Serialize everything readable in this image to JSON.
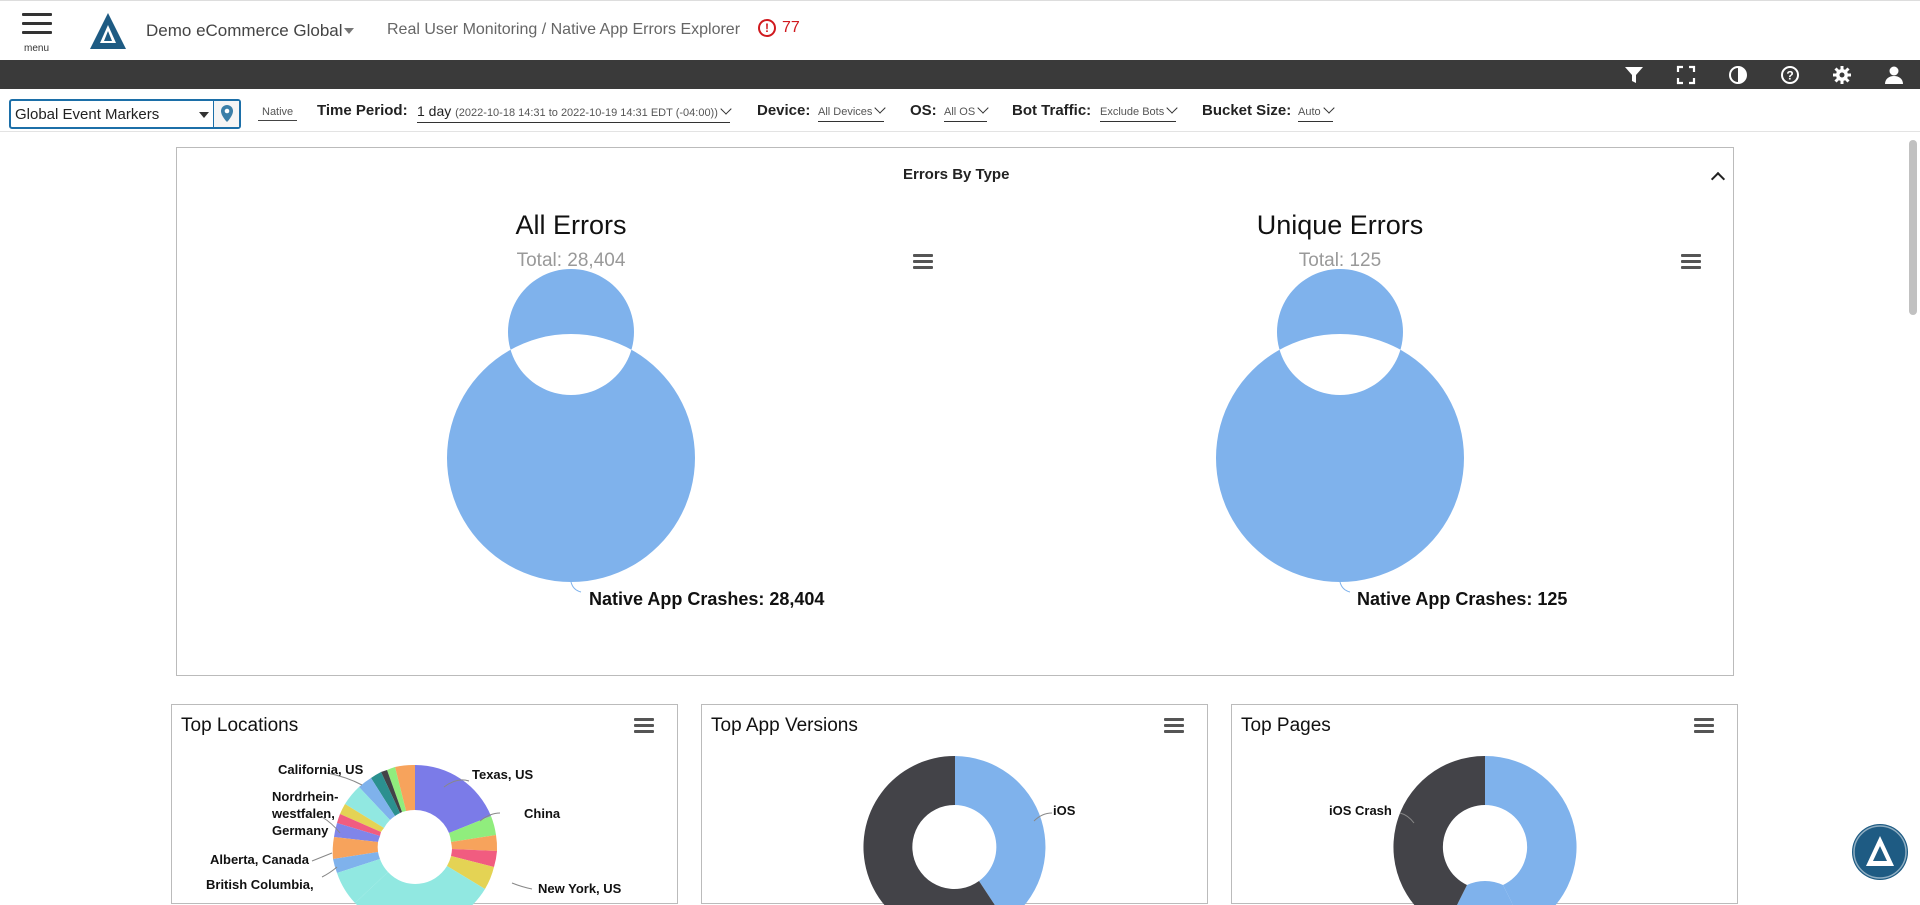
{
  "header": {
    "menu_label": "menu",
    "org_name": "Demo eCommerce Global",
    "breadcrumb": "Real User Monitoring / Native App Errors Explorer",
    "alert_count": "77"
  },
  "toolbar": {
    "icons": [
      "filter-icon",
      "fullscreen-icon",
      "contrast-icon",
      "help-icon",
      "gear-icon",
      "user-icon"
    ]
  },
  "filters": {
    "event_markers": "Global Event Markers",
    "platform": "Native",
    "time_period_label": "Time Period:",
    "time_period_value": "1 day",
    "time_period_range": "(2022-10-18 14:31 to 2022-10-19 14:31 EDT (-04:00))",
    "device_label": "Device:",
    "device_value": "All Devices",
    "os_label": "OS:",
    "os_value": "All OS",
    "bot_label": "Bot Traffic:",
    "bot_value": "Exclude Bots",
    "bucket_label": "Bucket Size:",
    "bucket_value": "Auto"
  },
  "errors_by_type": {
    "title": "Errors By Type",
    "all": {
      "title": "All Errors",
      "subtitle": "Total: 28,404",
      "slice_label": "Native App Crashes: 28,404"
    },
    "unique": {
      "title": "Unique Errors",
      "subtitle": "Total: 125",
      "slice_label": "Native App Crashes: 125"
    }
  },
  "top_locations": {
    "title": "Top Locations",
    "labels": {
      "california": "California, US",
      "texas": "Texas, US",
      "nordrhein": "Nordrhein-",
      "nordrhein2": "westfalen,",
      "nordrhein3": "Germany",
      "china": "China",
      "alberta": "Alberta, Canada",
      "british": "British Columbia,",
      "newyork": "New York, US"
    }
  },
  "top_app_versions": {
    "title": "Top App Versions",
    "label_ios": "iOS"
  },
  "top_pages": {
    "title": "Top Pages",
    "label_ios_crash": "iOS Crash"
  },
  "chart_data": [
    {
      "type": "pie",
      "title": "All Errors",
      "subtitle": "Total: 28,404",
      "categories": [
        "Native App Crashes"
      ],
      "values": [
        28404
      ]
    },
    {
      "type": "pie",
      "title": "Unique Errors",
      "subtitle": "Total: 125",
      "categories": [
        "Native App Crashes"
      ],
      "values": [
        125
      ]
    }
  ],
  "colors": {
    "accent": "#1c6fa8",
    "donut_blue": "#7fb2ec",
    "dark_slice": "#434348",
    "alert_red": "#d0191e",
    "toolbar_bg": "#3a3a3a"
  }
}
